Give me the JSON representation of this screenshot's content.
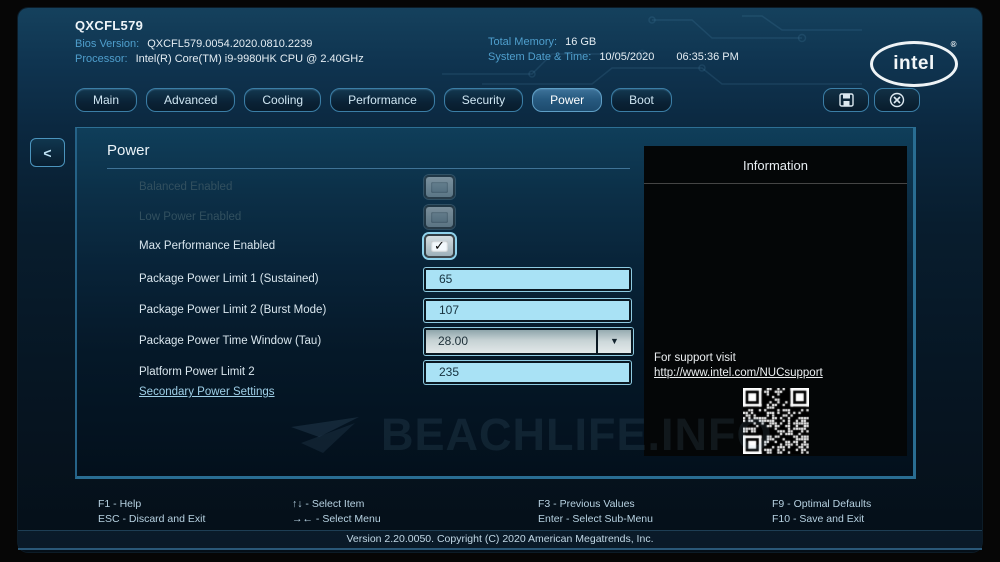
{
  "header": {
    "model": "QXCFL579",
    "bios_version_label": "Bios Version:",
    "bios_version": "QXCFL579.0054.2020.0810.2239",
    "processor_label": "Processor:",
    "processor": "Intel(R) Core(TM) i9-9980HK CPU @ 2.40GHz",
    "total_memory_label": "Total Memory:",
    "total_memory": "16 GB",
    "datetime_label": "System Date & Time:",
    "date": "10/05/2020",
    "time": "06:35:36 PM",
    "logo_text": "intel",
    "logo_mark": "®"
  },
  "tabs": [
    {
      "label": "Main",
      "active": false
    },
    {
      "label": "Advanced",
      "active": false
    },
    {
      "label": "Cooling",
      "active": false
    },
    {
      "label": "Performance",
      "active": false
    },
    {
      "label": "Security",
      "active": false
    },
    {
      "label": "Power",
      "active": true
    },
    {
      "label": "Boot",
      "active": false
    }
  ],
  "panel": {
    "title": "Power"
  },
  "icons": {
    "back_arrow": "<",
    "checkmark": "✓",
    "dropdown_arrow": "▼",
    "save": "floppy-disk",
    "close": "circle-x"
  },
  "form": {
    "rows": [
      {
        "label": "Balanced Enabled",
        "type": "checkbox",
        "checked": false,
        "disabled": true
      },
      {
        "label": "Low Power Enabled",
        "type": "checkbox",
        "checked": false,
        "disabled": true
      },
      {
        "label": "Max Performance Enabled",
        "type": "checkbox",
        "checked": true,
        "disabled": false
      },
      {
        "label": "Package Power Limit 1 (Sustained)",
        "type": "input",
        "value": "65"
      },
      {
        "label": "Package Power Limit 2 (Burst Mode)",
        "type": "input",
        "value": "107"
      },
      {
        "label": "Package Power Time Window (Tau)",
        "type": "dropdown",
        "value": "28.00"
      },
      {
        "label": "Platform Power Limit 2",
        "type": "input",
        "value": "235"
      }
    ],
    "link": "Secondary Power Settings"
  },
  "info": {
    "title": "Information",
    "support_text": "For support visit",
    "support_link": "http://www.intel.com/NUCsupport"
  },
  "watermark": "BEACHLIFE.INFO",
  "footer": {
    "hints": [
      "F1 - Help",
      "ESC - Discard and Exit",
      "↑↓ - Select Item",
      "→← - Select Menu",
      "F3 - Previous Values",
      "Enter - Select Sub-Menu",
      "F9 - Optimal Defaults",
      "F10 - Save and Exit"
    ],
    "version": "Version 2.20.0050. Copyright (C) 2020 American Megatrends, Inc."
  },
  "colors": {
    "accent": "#4f9fcd",
    "field_bg": "#a9e2f5",
    "active_tab_bg": "#2b5f85",
    "panel_border": "#296d92",
    "info_bg": "#040607"
  }
}
